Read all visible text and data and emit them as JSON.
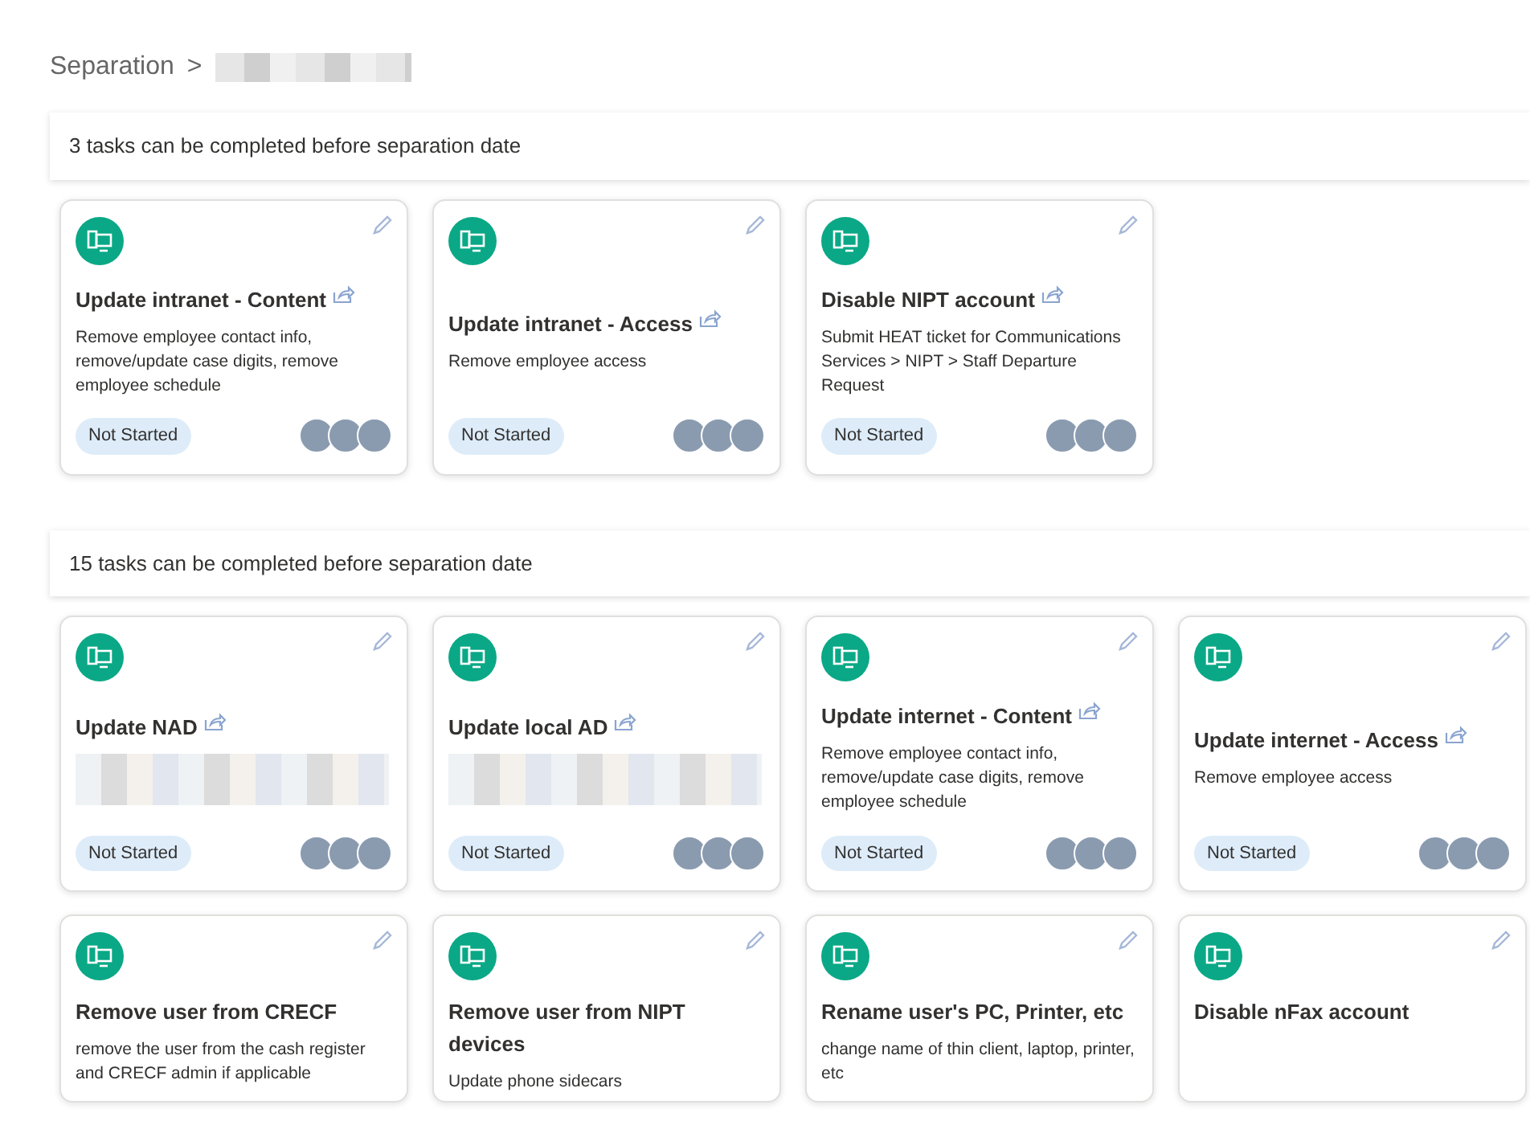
{
  "breadcrumb": {
    "root": "Separation",
    "separator": ">"
  },
  "sections": [
    {
      "heading": "3 tasks can be completed before separation date",
      "cards": [
        {
          "title": "Update intranet - Content",
          "shared": true,
          "description": "Remove employee contact info, remove/update case digits, remove employee schedule",
          "status": "Not Started"
        },
        {
          "title": "Update intranet - Access",
          "shared": true,
          "description": "Remove employee access",
          "status": "Not Started"
        },
        {
          "title": "Disable NIPT account",
          "shared": true,
          "description": "Submit HEAT ticket for Communications Services > NIPT > Staff Departure Request",
          "status": "Not Started"
        }
      ]
    },
    {
      "heading": "15 tasks can be completed before separation date",
      "cards": [
        {
          "title": "Update NAD",
          "shared": true,
          "redacted": true,
          "status": "Not Started"
        },
        {
          "title": "Update local AD",
          "shared": true,
          "redacted": true,
          "status": "Not Started"
        },
        {
          "title": "Update internet - Content",
          "shared": true,
          "description": "Remove employee contact info, remove/update case digits, remove employee schedule",
          "status": "Not Started"
        },
        {
          "title": "Update internet - Access",
          "shared": true,
          "description": "Remove employee access",
          "status": "Not Started"
        },
        {
          "title": "Remove user from CRECF",
          "shared": false,
          "description": "remove the user from the cash register and CRECF admin if applicable"
        },
        {
          "title": "Remove user from NIPT devices",
          "shared": false,
          "description": "Update phone sidecars"
        },
        {
          "title": "Rename user's PC, Printer, etc",
          "shared": false,
          "description": "change name of thin client, laptop, printer, etc"
        },
        {
          "title": "Disable nFax account",
          "shared": false
        }
      ]
    }
  ]
}
